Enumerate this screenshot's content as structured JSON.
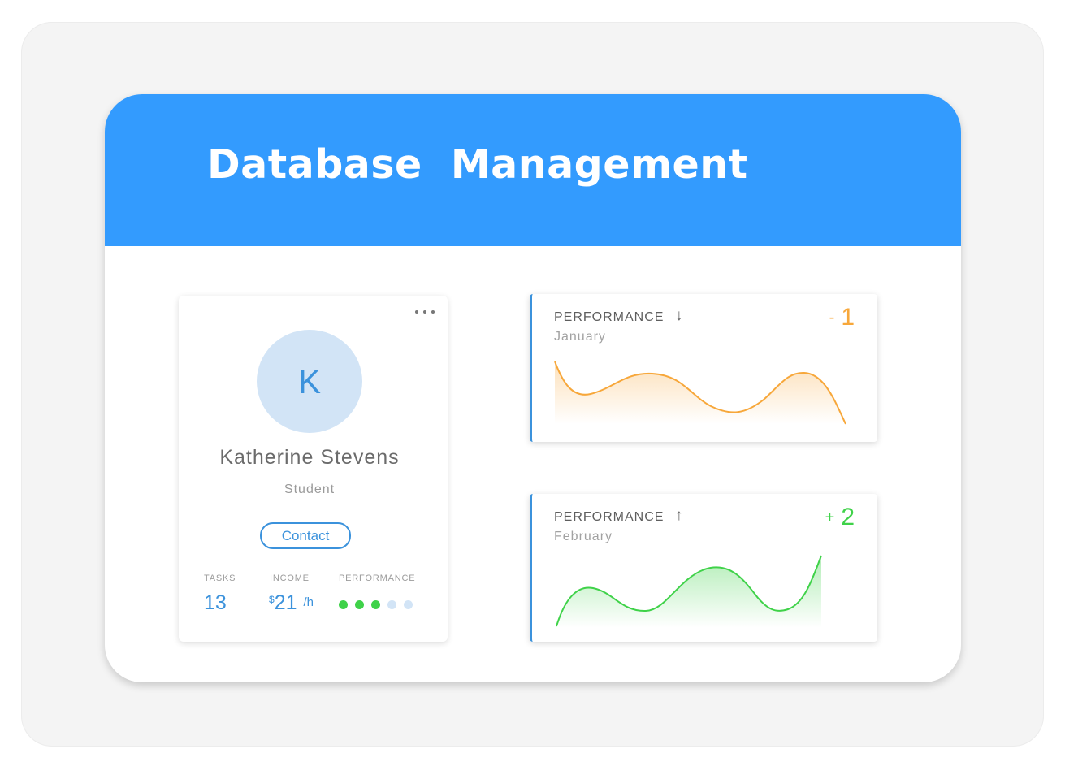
{
  "header": {
    "title": "Database  Management",
    "color": "#339bfe"
  },
  "profile": {
    "avatar_letter": "K",
    "name": "Katherine Stevens",
    "role": "Student",
    "contact_label": "Contact",
    "stats": {
      "tasks_label": "TASKS",
      "tasks_value": "13",
      "income_label": "INCOME",
      "income_currency": "$",
      "income_value": "21",
      "income_unit": "/h",
      "performance_label": "PERFORMANCE",
      "performance_filled": 3,
      "performance_total": 5
    },
    "colors": {
      "accent": "#3b92dc",
      "dot_on": "#3fd249",
      "dot_off": "#d2e4f6"
    }
  },
  "performance_cards": [
    {
      "title": "PERFORMANCE",
      "arrow_icon": "arrow-down-icon",
      "arrow": "↓",
      "month": "January",
      "delta_sign": "-",
      "delta_value": "1",
      "color": "#f7a73a"
    },
    {
      "title": "PERFORMANCE",
      "arrow_icon": "arrow-up-icon",
      "arrow": "↑",
      "month": "February",
      "delta_sign": "+",
      "delta_value": "2",
      "color": "#3fd249"
    }
  ]
}
